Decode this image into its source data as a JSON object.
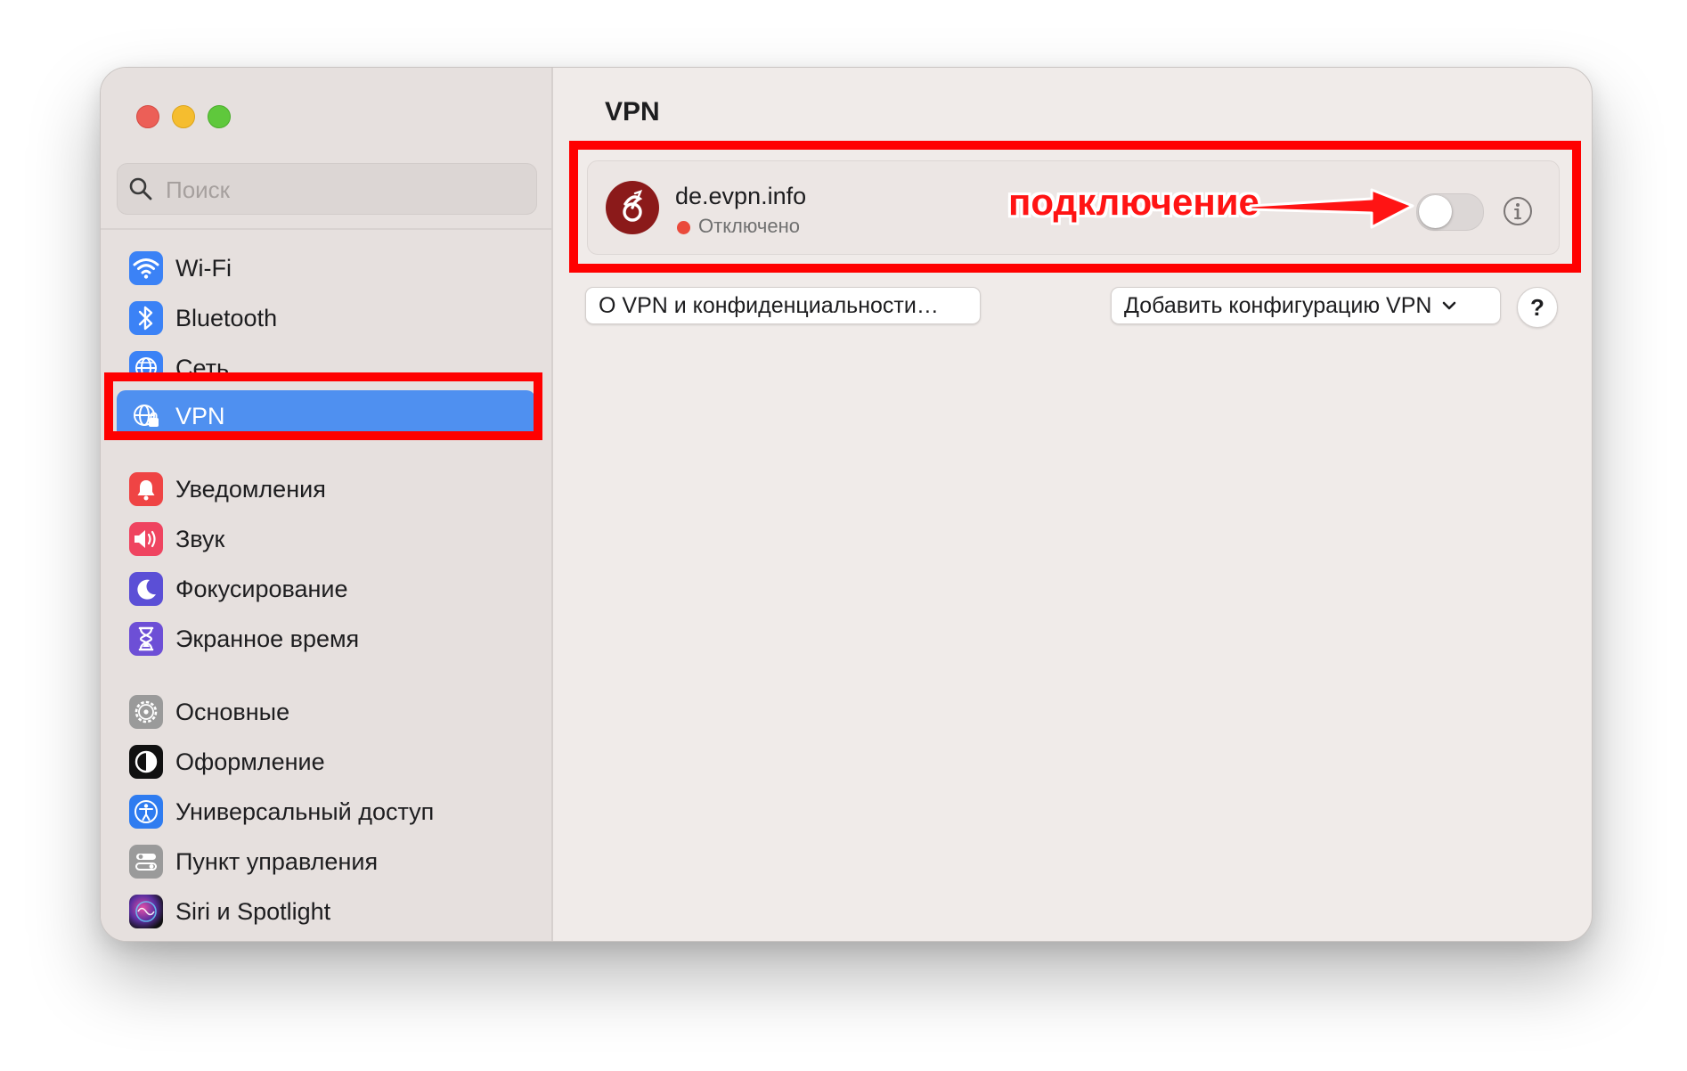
{
  "window": {
    "title": "VPN"
  },
  "search": {
    "placeholder": "Поиск"
  },
  "sidebar": {
    "items": [
      {
        "label": "Wi-Fi",
        "icon": "wifi-icon",
        "color": "#3b82f6"
      },
      {
        "label": "Bluetooth",
        "icon": "bluetooth-icon",
        "color": "#3b82f6"
      },
      {
        "label": "Сеть",
        "icon": "globe-icon",
        "color": "#3b82f6"
      },
      {
        "label": "VPN",
        "icon": "vpn-globe-icon",
        "color": "#3b82f6",
        "selected": true
      },
      {
        "label": "Уведомления",
        "icon": "bell-icon",
        "color": "#ef4444"
      },
      {
        "label": "Звук",
        "icon": "speaker-icon",
        "color": "#ef4460"
      },
      {
        "label": "Фокусирование",
        "icon": "moon-icon",
        "color": "#5b4fd6"
      },
      {
        "label": "Экранное время",
        "icon": "hourglass-icon",
        "color": "#6d4fd6"
      },
      {
        "label": "Основные",
        "icon": "gear-icon",
        "color": "#9a9a9a"
      },
      {
        "label": "Оформление",
        "icon": "appearance-icon",
        "color": "#111111"
      },
      {
        "label": "Универсальный доступ",
        "icon": "accessibility-icon",
        "color": "#2f7cf0"
      },
      {
        "label": "Пункт управления",
        "icon": "control-center-icon",
        "color": "#9a9a9a"
      },
      {
        "label": "Siri и Spotlight",
        "icon": "siri-icon",
        "color": "#5a2fa0"
      }
    ]
  },
  "vpn": {
    "name": "de.evpn.info",
    "status": "Отключено",
    "status_color": "#ea4a3b",
    "connected": false
  },
  "annotation": {
    "text": "подключение",
    "color": "#ff1414"
  },
  "buttons": {
    "about": "О VPN и конфиденциальности…",
    "add_config": "Добавить конфигурацию VPN",
    "help": "?"
  },
  "colors": {
    "accent": "#4f90f0",
    "highlight": "#ff0000"
  }
}
